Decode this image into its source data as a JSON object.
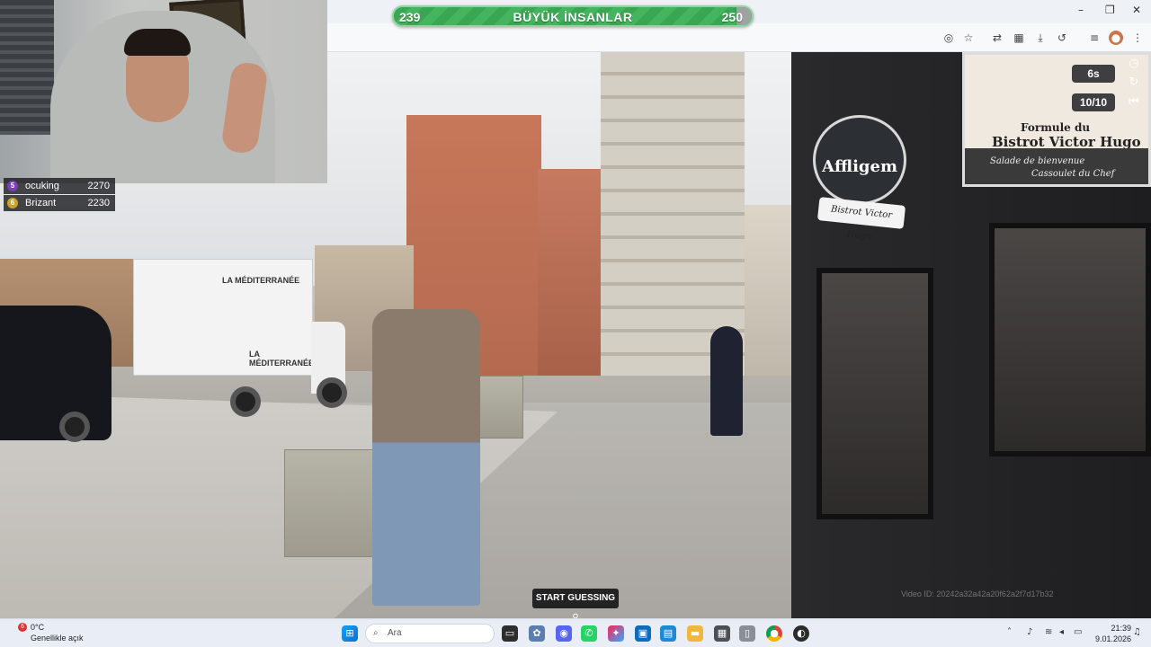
{
  "game": {
    "score_left": "239",
    "score_right": "250",
    "title": "BÜYÜK İNSANLAR",
    "progress_percent": 95.6,
    "timer": "6s",
    "round": "10/10",
    "start_button": "START GUESSING",
    "watermark": "Video ID: 20242a32a42a20f62a2f7d17b32"
  },
  "leaderboard": [
    {
      "rank": "5",
      "name": "ocuking",
      "points": "2270",
      "color": "#7b3fb2"
    },
    {
      "rank": "6",
      "name": "Brizant",
      "points": "2230",
      "color": "#c9a227"
    }
  ],
  "scene": {
    "sign_brand": "Affligem",
    "sign_ribbon": "Bistrot Victor Hugo",
    "menu_line1": "Formule du",
    "menu_line2": "Bistrot Victor Hugo",
    "menu_line3": "Salade de bienvenue",
    "menu_line4": "Cassoulet du Chef",
    "truck_label_top": "LA MÉDITERRANÉE",
    "truck_label_bottom": "LA MÉDITERRANÉE"
  },
  "browser": {
    "window_controls": [
      "–",
      "❐",
      "✕"
    ],
    "toolbar_icons": [
      "eye-off-icon",
      "star-icon",
      "translate-icon",
      "extensions-icon",
      "download-icon",
      "history-icon",
      "media-icon",
      "profile-icon",
      "menu-icon"
    ]
  },
  "taskbar": {
    "weather_temp": "0°C",
    "weather_cond": "Genellikle açık",
    "weather_badge": "6",
    "search_text": "Ara",
    "time": "21:39",
    "date": "9.01.2026"
  },
  "colors": {
    "progress_green": "#2f9a49",
    "hud_dark": "#19191e",
    "taskbar_bg": "#e9eef6"
  }
}
